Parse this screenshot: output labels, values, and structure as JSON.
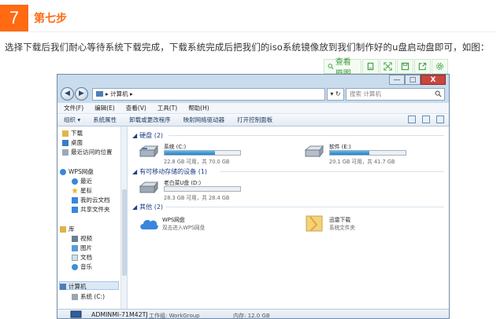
{
  "step": {
    "number": "7",
    "title": "第七步"
  },
  "paragraph": "选择下载后我们耐心等待系统下载完成，下载系统完成后把我们的iso系统镜像放到我们制作好的u盘启动盘即可，如图：",
  "float_toolbar": {
    "origin_label": "查看原图",
    "icons": [
      "toolbar-icon",
      "expand-icon",
      "save-icon",
      "share-icon",
      "settings-icon"
    ],
    "accent": "#3c9b3c"
  },
  "window": {
    "controls": {
      "min": "—",
      "max": "□",
      "close": "X"
    },
    "address": {
      "path": "▸ 计算机 ▸",
      "refresh": "▾ ↻",
      "search_placeholder": "搜索 计算机"
    },
    "menu": [
      "文件(F)",
      "编辑(E)",
      "查看(V)",
      "工具(T)",
      "帮助(H)"
    ],
    "commands": [
      "组织 ▾",
      "系统属性",
      "卸载或更改程序",
      "映射网络驱动器",
      "打开控制面板"
    ],
    "nav": {
      "favorites": [
        "下载",
        "桌面",
        "最近访问的位置"
      ],
      "wps": {
        "label": "WPS网盘",
        "items": [
          "最近",
          "星标",
          "我的云文档",
          "共享文件夹"
        ]
      },
      "library": {
        "label": "库",
        "items": [
          "视频",
          "图片",
          "文档",
          "音乐"
        ]
      },
      "computer": {
        "label": "计算机",
        "items": [
          "系统 (C:)"
        ]
      }
    },
    "groups": {
      "hdd": "硬盘 (2)",
      "removable": "有可移动存储的设备 (1)",
      "other": "其他 (2)"
    },
    "drives": [
      {
        "name": "系统 (C:)",
        "size": "22.8 GB 可用，共 70.0 GB",
        "used_fraction": 0.67
      },
      {
        "name": "软件 (E:)",
        "size": "20.1 GB 可用，共 41.7 GB",
        "used_fraction": 0.52
      },
      {
        "name": "老白菜U盘 (D:)",
        "size": "28.3 GB 可用，共 28.4 GB",
        "used_fraction": 0.004
      }
    ],
    "others": [
      {
        "name": "WPS网盘",
        "desc": "双击进入WPS网盘"
      },
      {
        "name": "迅雷下载",
        "desc": "系统文件夹"
      }
    ],
    "status": {
      "computer": "ADMINMI-71M42TJ",
      "workgroup": "工作组: WorkGroup",
      "memory": "内存: 12.0 GB"
    }
  },
  "colors": {
    "step_orange": "#ff6a13",
    "drive_bar": "#2a7fbf",
    "group_blue": "#1e3f8a"
  }
}
